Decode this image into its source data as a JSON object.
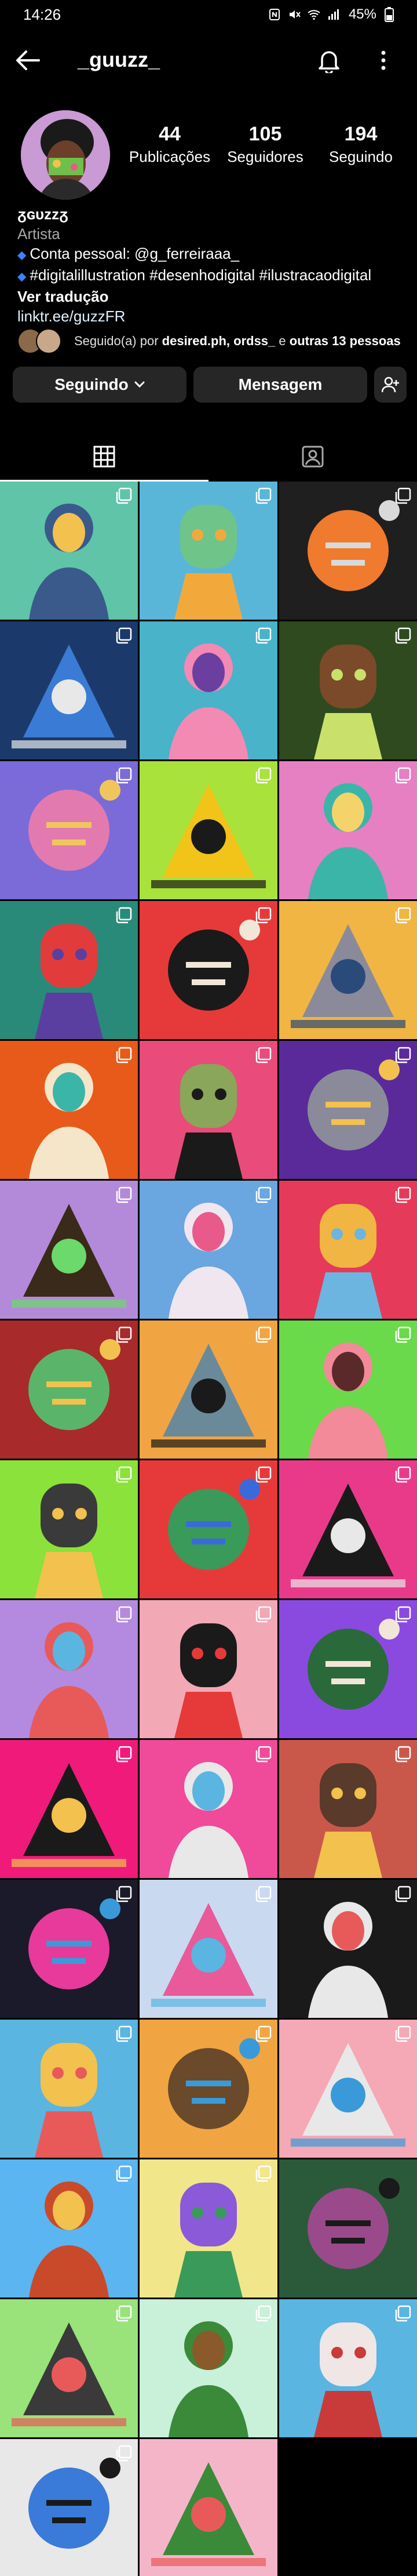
{
  "status_bar": {
    "time": "14:26",
    "battery": "45%"
  },
  "header": {
    "username": "_guuzz_"
  },
  "profile": {
    "display_name": "ᵹɢᴜᴢᴢᵹ",
    "category": "Artista",
    "bio_line1": "Conta pessoal: @g_ferreiraaa_",
    "bio_line2": "#digitalillustration #desenhodigital #ilustracaodigital",
    "translate": "Ver tradução",
    "link": "linktr.ee/guzzFR",
    "stats": [
      {
        "value": "44",
        "label": "Publicações"
      },
      {
        "value": "105",
        "label": "Seguidores"
      },
      {
        "value": "194",
        "label": "Seguindo"
      }
    ],
    "followed_prefix": "Seguido(a) por ",
    "followed_names": "desired.ph, ordss_",
    "followed_mid": " e ",
    "followed_others": "outras 13 pessoas"
  },
  "actions": {
    "following": "Seguindo",
    "message": "Mensagem"
  },
  "tabs": [
    {
      "name": "posts",
      "icon": "grid-icon"
    },
    {
      "name": "tagged",
      "icon": "tagged-icon"
    }
  ],
  "colors": {
    "accent_blue": "#3b82f6",
    "button_bg": "#262626"
  },
  "posts": [
    {
      "bg": "#5fc4a8",
      "fg": "#3a5a8c",
      "accent": "#f2c14e",
      "multi": true
    },
    {
      "bg": "#59b6d9",
      "fg": "#6fc48a",
      "accent": "#f2a93b",
      "multi": true
    },
    {
      "bg": "#1f1f1f",
      "fg": "#f07a2d",
      "accent": "#d9d9d9",
      "multi": true
    },
    {
      "bg": "#1b3a6b",
      "fg": "#3a7bd5",
      "accent": "#e8e8e8",
      "multi": true
    },
    {
      "bg": "#48b3c9",
      "fg": "#f28ab3",
      "accent": "#6b3fa0",
      "multi": true
    },
    {
      "bg": "#2f4a1e",
      "fg": "#7a4a2a",
      "accent": "#c9e06b",
      "multi": true
    },
    {
      "bg": "#7a6bd9",
      "fg": "#e27ab0",
      "accent": "#f0c65c",
      "multi": true
    },
    {
      "bg": "#a8e23a",
      "fg": "#f2c318",
      "accent": "#1a1a1a",
      "multi": true
    },
    {
      "bg": "#e680c2",
      "fg": "#3bb5a8",
      "accent": "#f5d36b",
      "multi": true
    },
    {
      "bg": "#2a8a7a",
      "fg": "#e23b3b",
      "accent": "#5a3fa0",
      "multi": true
    },
    {
      "bg": "#e63a3a",
      "fg": "#1a1a1a",
      "accent": "#f2e6d9",
      "multi": true
    },
    {
      "bg": "#f0b542",
      "fg": "#8a8a9a",
      "accent": "#2a4a7a",
      "multi": true
    },
    {
      "bg": "#e85a1a",
      "fg": "#f5e6c9",
      "accent": "#3bb5a8",
      "multi": true
    },
    {
      "bg": "#e94b7a",
      "fg": "#8aa65a",
      "accent": "#1a1a1a",
      "multi": true
    },
    {
      "bg": "#5a2a9a",
      "fg": "#8a8a9a",
      "accent": "#f2c14e",
      "multi": true
    },
    {
      "bg": "#b38ad9",
      "fg": "#3a2a1a",
      "accent": "#6bd96b",
      "multi": true
    },
    {
      "bg": "#6aa6e0",
      "fg": "#f0e6f0",
      "accent": "#e85a8a",
      "multi": true
    },
    {
      "bg": "#e63a5a",
      "fg": "#f0b542",
      "accent": "#6bb5e0",
      "multi": true
    },
    {
      "bg": "#a82a2a",
      "fg": "#5ab56b",
      "accent": "#f2c14e",
      "multi": true
    },
    {
      "bg": "#f0a542",
      "fg": "#6a8a9a",
      "accent": "#1a1a1a",
      "multi": true
    },
    {
      "bg": "#6ad94a",
      "fg": "#f28a9a",
      "accent": "#5a2a2a",
      "multi": true
    },
    {
      "bg": "#8ae23a",
      "fg": "#3a3a3a",
      "accent": "#f2c14e",
      "multi": true
    },
    {
      "bg": "#e63a3a",
      "fg": "#3a9a5a",
      "accent": "#3a6ad9",
      "multi": true
    },
    {
      "bg": "#e93a8a",
      "fg": "#1a1a1a",
      "accent": "#e8e8e8",
      "multi": true
    },
    {
      "bg": "#b38ae0",
      "fg": "#e85a5a",
      "accent": "#5ab5e0",
      "multi": true
    },
    {
      "bg": "#f2a8b5",
      "fg": "#1a1a1a",
      "accent": "#e63a3a",
      "multi": true
    },
    {
      "bg": "#8a4ae0",
      "fg": "#2a6a3a",
      "accent": "#f2e6d9",
      "multi": true
    },
    {
      "bg": "#f01a7a",
      "fg": "#1a1a1a",
      "accent": "#f2c14e",
      "multi": true
    },
    {
      "bg": "#f04a9a",
      "fg": "#e8e8e8",
      "accent": "#5ab5e0",
      "multi": true
    },
    {
      "bg": "#c9584a",
      "fg": "#5a3a2a",
      "accent": "#f2c14e",
      "multi": true
    },
    {
      "bg": "#1a1a2a",
      "fg": "#e83a9a",
      "accent": "#3a9ad9",
      "multi": true
    },
    {
      "bg": "#c9d9f0",
      "fg": "#e85a9a",
      "accent": "#5ab5e0",
      "multi": true
    },
    {
      "bg": "#1a1a1a",
      "fg": "#e8e8e8",
      "accent": "#e85a5a",
      "multi": true
    },
    {
      "bg": "#5ab5e0",
      "fg": "#f2c14e",
      "accent": "#e85a5a",
      "multi": true
    },
    {
      "bg": "#f0a542",
      "fg": "#6a4a2a",
      "accent": "#3a9ad9",
      "multi": true
    },
    {
      "bg": "#f5a8b5",
      "fg": "#e8e8e8",
      "accent": "#3a9ad9",
      "multi": true
    },
    {
      "bg": "#5ab5f0",
      "fg": "#c94a2a",
      "accent": "#f2c14e",
      "multi": true
    },
    {
      "bg": "#f2e68a",
      "fg": "#8a5ad9",
      "accent": "#3a9a5a",
      "multi": true
    },
    {
      "bg": "#2a5a3a",
      "fg": "#9a4a8a",
      "accent": "#1a1a1a",
      "multi": false
    },
    {
      "bg": "#9ae27a",
      "fg": "#3a3a3a",
      "accent": "#e85a5a",
      "multi": true
    },
    {
      "bg": "#c9f0d9",
      "fg": "#3a8a3a",
      "accent": "#8a5a2a",
      "multi": true
    },
    {
      "bg": "#5ab5e0",
      "fg": "#f0e6e6",
      "accent": "#c93a3a",
      "multi": true
    },
    {
      "bg": "#e8e8e8",
      "fg": "#3a7ad9",
      "accent": "#1a1a1a",
      "multi": true
    },
    {
      "bg": "#f5b5c9",
      "fg": "#3a8a3a",
      "accent": "#e85a5a",
      "multi": false
    }
  ]
}
